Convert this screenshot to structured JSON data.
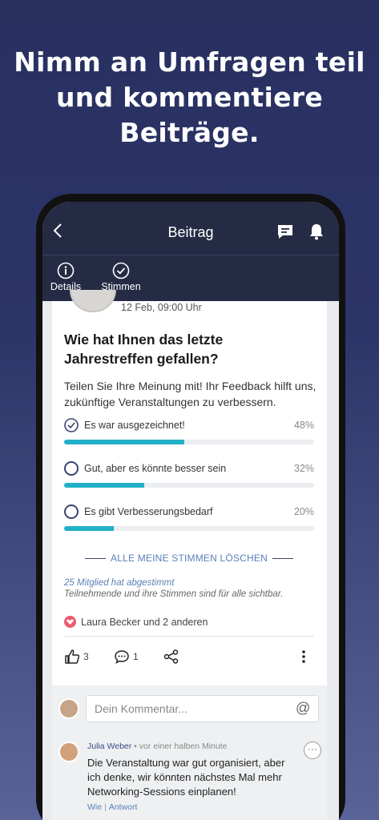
{
  "headline": "Nimm an Umfragen teil\nund kommentiere\nBeiträge.",
  "appbar": {
    "back_icon": "chevron-left-icon",
    "title": "Beitrag",
    "chat_icon": "chat-icon",
    "bell_icon": "bell-icon"
  },
  "tabs": [
    {
      "label": "Details",
      "icon": "info-icon",
      "active": true
    },
    {
      "label": "Stimmen",
      "icon": "check-circle-icon",
      "active": false
    }
  ],
  "post": {
    "date": "12 Feb, 09:00 Uhr",
    "question": "Wie hat Ihnen das letzte Jahrestreffen gefallen?",
    "description": "Teilen Sie Ihre Meinung mit! Ihr Feedback hilft uns, zukünftige Veranstaltungen zu verbessern."
  },
  "poll": {
    "accent_color": "#22b0c8",
    "options": [
      {
        "label": "Es war ausgezeichnet!",
        "percent_label": "48%",
        "fraction": 0.48,
        "selected": true
      },
      {
        "label": "Gut, aber es könnte besser sein",
        "percent_label": "32%",
        "fraction": 0.32,
        "selected": false
      },
      {
        "label": "Es gibt Verbesserungsbedarf",
        "percent_label": "20%",
        "fraction": 0.2,
        "selected": false
      }
    ],
    "clear_label": "ALLE MEINE STIMMEN LÖSCHEN",
    "voted_count": "25 Mitglied hat abgestimmt",
    "visibility_note": "Teilnehmende und ihre Stimmen sind für alle sichtbar."
  },
  "reactions": {
    "likes_text": "Laura Becker und 2 anderen",
    "heart_color": "#ef5a6f"
  },
  "actions": {
    "like_count": "3",
    "comment_count": "1"
  },
  "comment_box": {
    "placeholder": "Dein Kommentar...",
    "at_symbol": "@"
  },
  "comment": {
    "author": "Julia Weber",
    "meta": " • vor einer halben Minute",
    "text": "Die Veranstaltung war gut organisiert, aber ich denke, wir könnten nächstes Mal mehr Networking-Sessions einplanen!",
    "like_label": "Wie",
    "separator": "|",
    "reply_label": "Antwort",
    "more": "···"
  }
}
